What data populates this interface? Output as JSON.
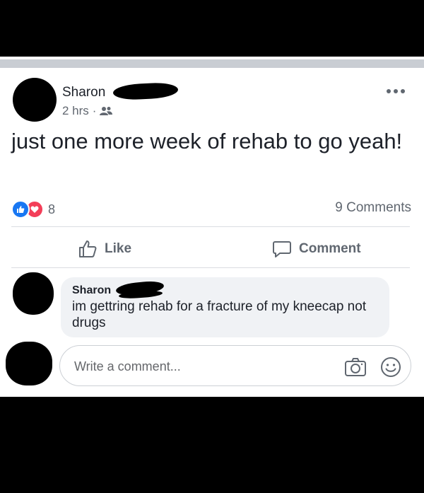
{
  "post": {
    "author_name": "Sharon",
    "time": "2 hrs",
    "separator": "·",
    "text": "just one more week of rehab to go yeah!",
    "reaction_count": "8",
    "comments_count": "9 Comments"
  },
  "actions": {
    "like_label": "Like",
    "comment_label": "Comment"
  },
  "comment": {
    "author_name": "Sharon",
    "text": "im gettring rehab for a fracture of my kneecap not drugs"
  },
  "composer": {
    "placeholder": "Write a comment..."
  },
  "icons": {
    "audience": "friends-icon",
    "more": "more-options-icon",
    "like_reaction": "thumbs-up-icon",
    "love_reaction": "heart-icon",
    "like_button": "thumbs-up-outline-icon",
    "comment_button": "speech-bubble-icon",
    "camera": "camera-icon",
    "emoji": "smiley-icon"
  },
  "colors": {
    "like_blue": "#1877f2",
    "love_red": "#f33e58",
    "secondary_text": "#606770"
  }
}
